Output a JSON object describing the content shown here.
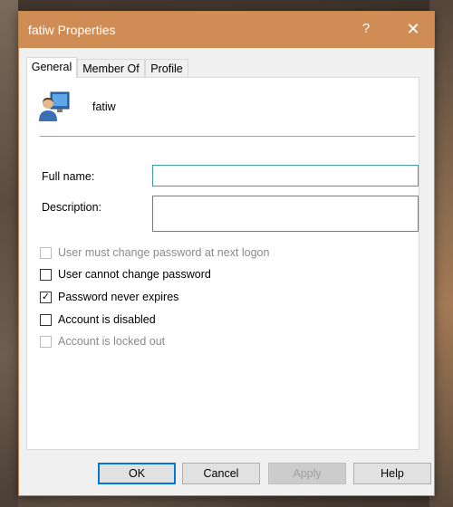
{
  "window": {
    "title": "fatiw Properties",
    "help_label": "?",
    "close_label": "✕"
  },
  "tabs": [
    {
      "label": "General",
      "active": true
    },
    {
      "label": "Member Of",
      "active": false
    },
    {
      "label": "Profile",
      "active": false
    }
  ],
  "user": {
    "name": "fatiw",
    "icon": "user-icon"
  },
  "fields": {
    "full_name_label": "Full name:",
    "full_name_value": "",
    "description_label": "Description:",
    "description_value": ""
  },
  "checkboxes": [
    {
      "label": "User must change password at next logon",
      "checked": false,
      "enabled": false
    },
    {
      "label": "User cannot change password",
      "checked": false,
      "enabled": true
    },
    {
      "label": "Password never expires",
      "checked": true,
      "enabled": true
    },
    {
      "label": "Account is disabled",
      "checked": false,
      "enabled": true
    },
    {
      "label": "Account is locked out",
      "checked": false,
      "enabled": false
    }
  ],
  "buttons": {
    "ok": "OK",
    "cancel": "Cancel",
    "apply": "Apply",
    "help": "Help"
  },
  "colors": {
    "titlebar": "#cf8c54",
    "focus_border": "#3c9fa3",
    "default_button_border": "#0078d7"
  }
}
